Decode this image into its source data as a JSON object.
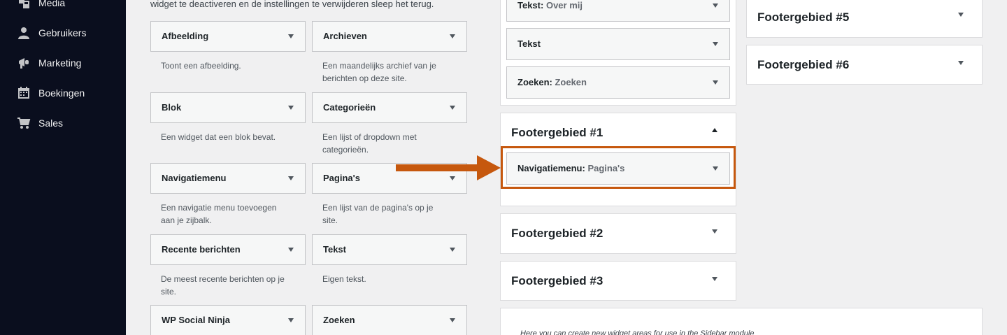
{
  "sidebar": {
    "items": [
      {
        "label": "Media",
        "icon": "media-icon"
      },
      {
        "label": "Gebruikers",
        "icon": "user-icon"
      },
      {
        "label": "Marketing",
        "icon": "megaphone-icon"
      },
      {
        "label": "Boekingen",
        "icon": "calendar-icon"
      },
      {
        "label": "Sales",
        "icon": "cart-icon"
      }
    ]
  },
  "available_widgets": {
    "intro": "widget te deactiveren en de instellingen te verwijderen sleep het terug.",
    "widgets": [
      {
        "title": "Afbeelding",
        "desc_1": "Toont een afbeelding.",
        "desc_2": ""
      },
      {
        "title": "Archieven",
        "desc_1": "Een maandelijks archief van je",
        "desc_2": "berichten op deze site."
      },
      {
        "title": "Blok",
        "desc_1": "Een widget dat een blok bevat.",
        "desc_2": ""
      },
      {
        "title": "Categorieën",
        "desc_1": "Een lijst of dropdown met",
        "desc_2": "categorieën."
      },
      {
        "title": "Navigatiemenu",
        "desc_1": "Een navigatie menu toevoegen",
        "desc_2": "aan je zijbalk."
      },
      {
        "title": "Pagina's",
        "desc_1": "Een lijst van de pagina's op je",
        "desc_2": "site."
      },
      {
        "title": "Recente berichten",
        "desc_1": "De meest recente berichten op je",
        "desc_2": "site."
      },
      {
        "title": "Tekst",
        "desc_1": "Eigen tekst.",
        "desc_2": ""
      },
      {
        "title": "WP Social Ninja",
        "desc_1": "",
        "desc_2": ""
      },
      {
        "title": "Zoeken",
        "desc_1": "",
        "desc_2": ""
      }
    ]
  },
  "top_area": {
    "widgets": [
      {
        "title": "Tekst",
        "sub": "Over mij"
      },
      {
        "title": "Tekst",
        "sub": ""
      },
      {
        "title": "Zoeken",
        "sub": "Zoeken"
      }
    ]
  },
  "footer_areas": {
    "f1": {
      "title": "Footergebied #1",
      "widget_title": "Navigatiemenu",
      "widget_sub": "Pagina's"
    },
    "f2": {
      "title": "Footergebied #2"
    },
    "f3": {
      "title": "Footergebied #3"
    },
    "f5": {
      "title": "Footergebied #5"
    },
    "f6": {
      "title": "Footergebied #6"
    }
  },
  "custom_area": {
    "text": "Here you can create new widget areas for use in the Sidebar module"
  },
  "colors": {
    "sidebar_bg": "#0a0e1e",
    "highlight": "#c6580e"
  }
}
